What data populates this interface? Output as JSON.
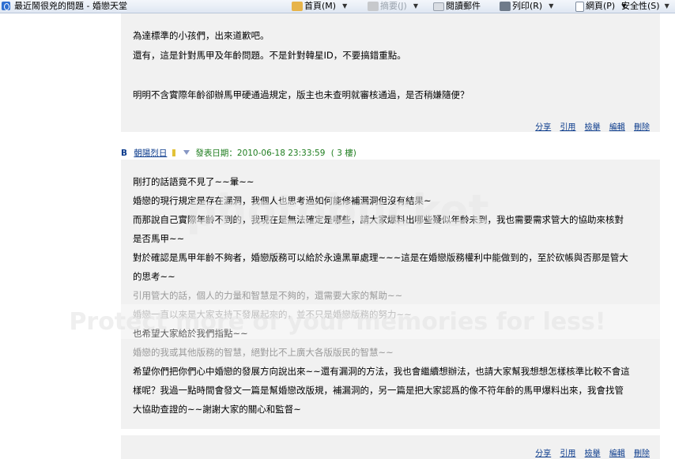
{
  "browser": {
    "tab_title": "最近鬧很兇的問題 - 婚戀天堂",
    "commands": {
      "home": "首頁(M)",
      "feeds": "摘要(J)",
      "read_mail": "閱讀郵件",
      "print": "列印(R)",
      "page": "網頁(P)",
      "safety": "安全性(S)"
    }
  },
  "post1": {
    "lines": [
      "為達標準的小孩們，出來道歉吧。",
      "還有，這是針對馬甲及年齡問題。不是針對韓星ID，不要搞錯重點。",
      "",
      "明明不含實際年齡卻辦馬甲硬通過規定，版主也未查明就審核通過，是否稍嫌隨便？"
    ],
    "actions": [
      "分享",
      "引用",
      "檢舉",
      "編輯",
      "刪除"
    ]
  },
  "post2": {
    "marker": "B",
    "author": "朝陽烈日",
    "date_label": "發表日期：2010-06-18 23:33:59",
    "floor": "( 3 樓)",
    "lines": [
      {
        "text": "剛打的話語竟不見了~~暈~~",
        "muted": false
      },
      {
        "text": "婚戀的現行規定是存在漏洞，我個人也思考過如何能修補漏洞但沒有結果~",
        "muted": false
      },
      {
        "text": "而那說自己實際年齡不到的，我現在是無法確定是哪些，請大家爆料出哪些疑似年齡未到，我也需要需求管大的協助來核對",
        "muted": false
      },
      {
        "text": "是否馬甲~~",
        "muted": false
      },
      {
        "text": "對於確認是馬甲年齡不夠者，婚戀版務可以給於永遠黑單處理~~~這是在婚戀版務權利中能做到的，至於砍帳與否那是管大",
        "muted": false
      },
      {
        "text": "的思考~~",
        "muted": false
      },
      {
        "text": "引用管大的話，個人的力量和智慧是不夠的，還需要大家的幫助~~",
        "muted": true
      },
      {
        "text": "婚戀一直以來是大家支持下發展起來的，並不只是婚戀版務的努力~~",
        "muted": true
      },
      {
        "text": "也希望大家給於我們指點~~",
        "muted": false
      },
      {
        "text": "婚戀的我或其他版務的智慧，絕對比不上廣大各版版民的智慧~~",
        "muted": true
      },
      {
        "text": "希望你們把你們心中婚戀的發展方向說出來~~還有漏洞的方法，我也會繼續想辦法，也請大家幫我想想怎樣核準比較不會這",
        "muted": false
      },
      {
        "text": "樣呢？我過一點時間會發文一篇是幫婚戀改版規，補漏洞的，另一篇是把大家認爲的像不符年齡的馬甲爆料出來，我會找管",
        "muted": false
      },
      {
        "text": "大協助查證的~~謝謝大家的關心和監督~",
        "muted": false
      }
    ],
    "actions": [
      "分享",
      "引用",
      "檢舉",
      "編輯",
      "刪除"
    ]
  },
  "watermark": {
    "line1": "photobucket",
    "line2": "Protect more of your memories for less!"
  },
  "colors": {
    "post_bg": "#f1f1f1",
    "link_blue": "#0b3b8c",
    "date_green": "#1e7d1e",
    "muted_text": "#9a9a9a"
  }
}
